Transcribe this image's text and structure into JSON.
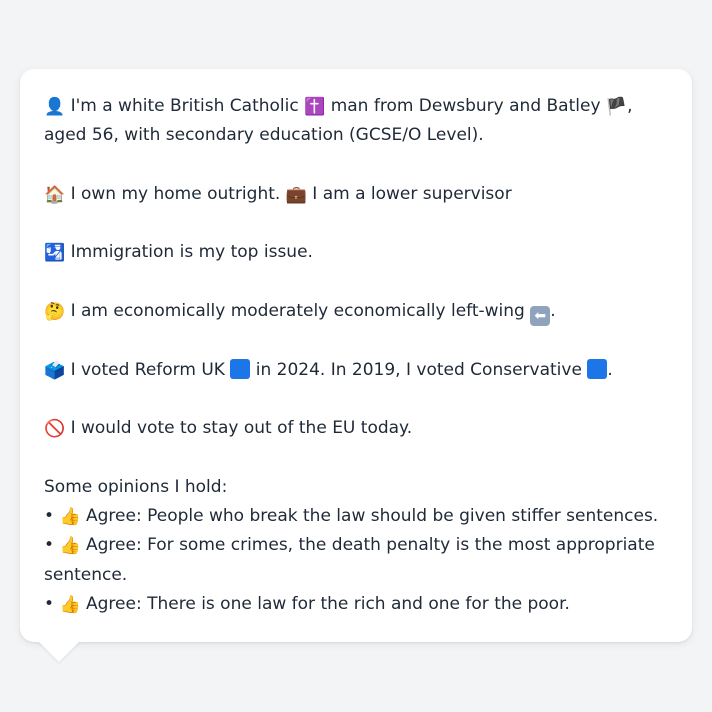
{
  "colors": {
    "background": "#f3f4f6",
    "bubble": "#ffffff",
    "text": "#1f2937",
    "reform_blue": "#1d76e8",
    "conservative_blue": "#1d76e8"
  },
  "profile": {
    "identity": {
      "icon": "👤",
      "text_a": "I'm a white British Catholic",
      "icon_religion": "✝️",
      "text_b": "man from Dewsbury and Batley",
      "icon_flag": "🏴",
      "text_c": ", aged 56, with secondary education (GCSE/O Level)."
    },
    "home": {
      "icon_house": "🏠",
      "text_home": "I own my home outright.",
      "icon_briefcase": "💼",
      "text_job": "I am a lower supervisor"
    },
    "issue": {
      "icon": "🛂",
      "text": "Immigration is my top issue."
    },
    "economics": {
      "icon": "🤔",
      "text": "I am economically moderately economically left-wing",
      "icon_arrow": "⬅",
      "suffix": "."
    },
    "vote": {
      "icon": "🗳️",
      "text_a": "I voted Reform UK",
      "text_b": "in 2024. In 2019, I voted Conservative",
      "suffix": "."
    },
    "eu": {
      "icon": "🚫",
      "text": "I would vote to stay out of the EU today."
    },
    "opinions": {
      "heading": "Some opinions I hold:",
      "bullet": "•",
      "thumb_icon": "👍",
      "items": [
        "Agree: People who break the law should be given stiffer sentences.",
        "Agree: For some crimes, the death penalty is the most appropriate sentence.",
        "Agree: There is one law for the rich and one for the poor."
      ]
    }
  }
}
